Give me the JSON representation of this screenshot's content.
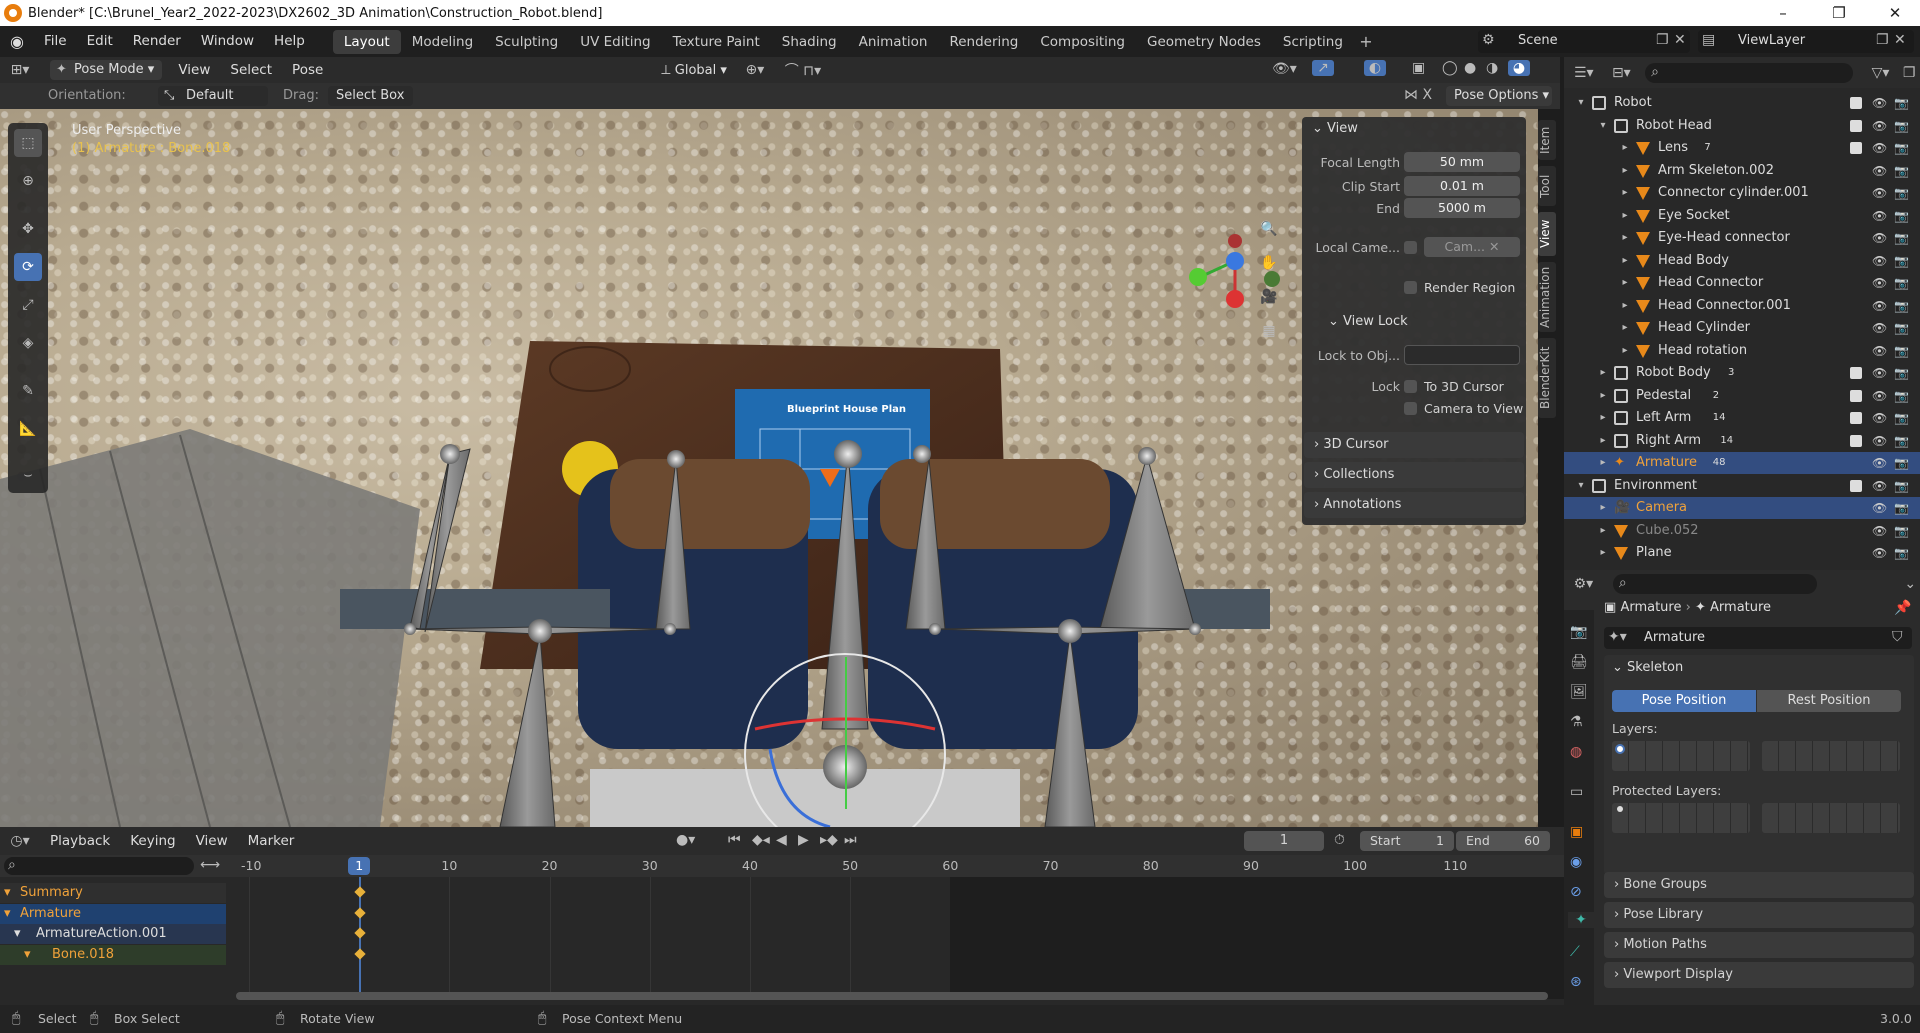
{
  "window": {
    "title": "Blender* [C:\\Brunel_Year2_2022-2023\\DX2602_3D Animation\\Construction_Robot.blend]"
  },
  "menu": [
    "File",
    "Edit",
    "Render",
    "Window",
    "Help"
  ],
  "workspaces": [
    "Layout",
    "Modeling",
    "Sculpting",
    "UV Editing",
    "Texture Paint",
    "Shading",
    "Animation",
    "Rendering",
    "Compositing",
    "Geometry Nodes",
    "Scripting"
  ],
  "active_workspace": "Layout",
  "scene": {
    "label": "Scene",
    "viewlayer": "ViewLayer"
  },
  "viewport_header": {
    "mode": "Pose Mode",
    "menus": [
      "View",
      "Select",
      "Pose"
    ],
    "transform": "Global"
  },
  "tool_settings": {
    "orientation_label": "Orientation:",
    "orientation_value": "Default",
    "drag_label": "Drag:",
    "drag_value": "Select Box",
    "pose_options": "Pose Options"
  },
  "viewport_overlay": {
    "perspective": "User Perspective",
    "object": "(1) Armature : Bone.018"
  },
  "npanel": {
    "view_title": "View",
    "focal_label": "Focal Length",
    "focal_value": "50 mm",
    "clip_start_label": "Clip Start",
    "clip_start_value": "0.01 m",
    "end_label": "End",
    "end_value": "5000 m",
    "local_camera_label": "Local Came...",
    "local_camera_value": "Cam...",
    "render_region": "Render Region",
    "view_lock_title": "View Lock",
    "lock_obj_label": "Lock to Obj...",
    "lock_label": "Lock",
    "to_cursor": "To 3D Cursor",
    "camera_to_view": "Camera to View",
    "cursor_panel": "3D Cursor",
    "collections_panel": "Collections",
    "annotations_panel": "Annotations"
  },
  "npanel_tabs": [
    "Item",
    "Tool",
    "View",
    "Animation",
    "BlenderKit"
  ],
  "texture_text": {
    "blueprint": "Blueprint House Plan"
  },
  "outliner": [
    {
      "label": "Robot",
      "indent": 0,
      "type": "collection",
      "expanded": true,
      "check": true
    },
    {
      "label": "Robot Head",
      "indent": 1,
      "type": "collection",
      "expanded": true,
      "check": true
    },
    {
      "label": "Lens",
      "indent": 2,
      "type": "mesh",
      "badge": "7",
      "check": true
    },
    {
      "label": "Arm Skeleton.002",
      "indent": 2,
      "type": "mesh"
    },
    {
      "label": "Connector cylinder.001",
      "indent": 2,
      "type": "mesh"
    },
    {
      "label": "Eye Socket",
      "indent": 2,
      "type": "mesh"
    },
    {
      "label": "Eye-Head connector",
      "indent": 2,
      "type": "mesh"
    },
    {
      "label": "Head Body",
      "indent": 2,
      "type": "mesh"
    },
    {
      "label": "Head Connector",
      "indent": 2,
      "type": "mesh"
    },
    {
      "label": "Head Connector.001",
      "indent": 2,
      "type": "mesh"
    },
    {
      "label": "Head Cylinder",
      "indent": 2,
      "type": "mesh"
    },
    {
      "label": "Head rotation",
      "indent": 2,
      "type": "mesh"
    },
    {
      "label": "Robot Body",
      "indent": 1,
      "type": "collection",
      "badge": "3",
      "check": true
    },
    {
      "label": "Pedestal",
      "indent": 1,
      "type": "collection",
      "badge": "2",
      "check": true
    },
    {
      "label": "Left Arm",
      "indent": 1,
      "type": "collection",
      "badge": "14",
      "check": true
    },
    {
      "label": "Right Arm",
      "indent": 1,
      "type": "collection",
      "badge": "14",
      "check": true
    },
    {
      "label": "Armature",
      "indent": 1,
      "type": "armature",
      "selected": true,
      "badge": "48"
    },
    {
      "label": "Environment",
      "indent": 0,
      "type": "collection",
      "expanded": true,
      "check": true
    },
    {
      "label": "Camera",
      "indent": 1,
      "type": "camera",
      "selected": true
    },
    {
      "label": "Cube.052",
      "indent": 1,
      "type": "mesh",
      "dim": true
    },
    {
      "label": "Plane",
      "indent": 1,
      "type": "mesh"
    }
  ],
  "properties": {
    "breadcrumb_obj": "Armature",
    "breadcrumb_data": "Armature",
    "data_name": "Armature",
    "skeleton_panel": "Skeleton",
    "pose_position": "Pose Position",
    "rest_position": "Rest Position",
    "layers_label": "Layers:",
    "protected_label": "Protected Layers:",
    "panels": [
      "Bone Groups",
      "Pose Library",
      "Motion Paths",
      "Viewport Display"
    ]
  },
  "timeline": {
    "menus": [
      "Playback",
      "Keying",
      "View",
      "Marker"
    ],
    "current_frame": "1",
    "start_label": "Start",
    "start": "1",
    "end_label": "End",
    "end": "60",
    "ticks": [
      "-10",
      "10",
      "20",
      "30",
      "40",
      "50",
      "60",
      "70",
      "80",
      "90",
      "100",
      "110"
    ],
    "playhead": "1",
    "channels": [
      {
        "label": "Summary",
        "level": 0,
        "style": "summary"
      },
      {
        "label": "Armature",
        "level": 0,
        "style": "object"
      },
      {
        "label": "ArmatureAction.001",
        "level": 1,
        "style": "action"
      },
      {
        "label": "Bone.018",
        "level": 2,
        "style": "group"
      }
    ]
  },
  "statusbar": {
    "select": "Select",
    "box_select": "Box Select",
    "rotate": "Rotate View",
    "context": "Pose Context Menu",
    "version": "3.0.0"
  }
}
